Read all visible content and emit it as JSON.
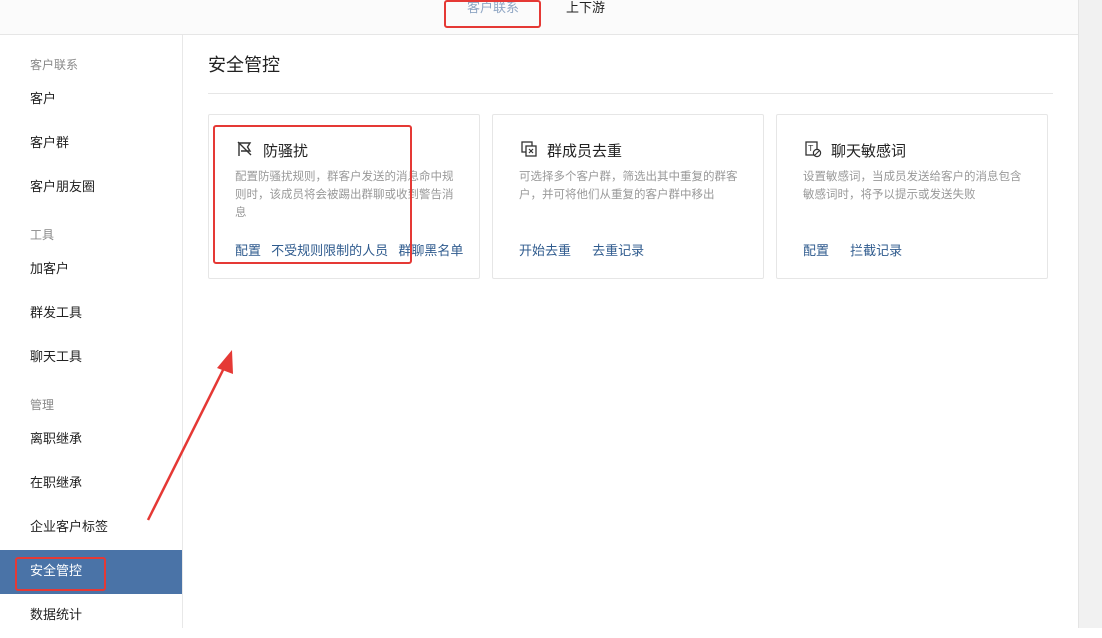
{
  "topbar": {
    "tabs": [
      {
        "label": "客户联系",
        "active": true
      },
      {
        "label": "上下游",
        "active": false
      }
    ]
  },
  "sidebar": {
    "groups": [
      {
        "title": "客户联系",
        "items": [
          "客户",
          "客户群",
          "客户朋友圈"
        ]
      },
      {
        "title": "工具",
        "items": [
          "加客户",
          "群发工具",
          "聊天工具"
        ]
      },
      {
        "title": "管理",
        "items": [
          "离职继承",
          "在职继承",
          "企业客户标签",
          "安全管控",
          "数据统计"
        ]
      }
    ],
    "active_item": "安全管控"
  },
  "main": {
    "title": "安全管控",
    "cards": [
      {
        "icon": "no-disturb-flag-icon",
        "title": "防骚扰",
        "description": "配置防骚扰规则，群客户发送的消息命中规则时，该成员将会被踢出群聊或收到警告消息",
        "links": [
          "配置",
          "不受规则限制的人员",
          "群聊黑名单"
        ]
      },
      {
        "icon": "dedupe-group-icon",
        "title": "群成员去重",
        "description": "可选择多个客户群，筛选出其中重复的群客户，并可将他们从重复的客户群中移出",
        "links": [
          "开始去重",
          "去重记录"
        ]
      },
      {
        "icon": "sensitive-word-icon",
        "title": "聊天敏感词",
        "description": "设置敏感词，当成员发送给客户的消息包含敏感词时，将予以提示或发送失败",
        "links": [
          "配置",
          "拦截记录"
        ]
      }
    ]
  },
  "colors": {
    "accent": "#4a73a7",
    "link": "#2f5b8e",
    "annotation_red": "#e53935"
  }
}
